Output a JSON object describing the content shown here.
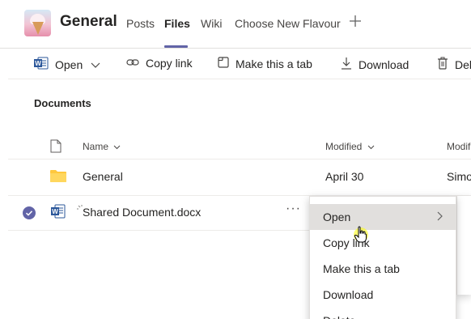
{
  "header": {
    "title": "General",
    "tabs": [
      "Posts",
      "Files",
      "Wiki",
      "Choose New Flavour"
    ],
    "active_tab": "Files",
    "add_tab_icon": "plus-icon"
  },
  "toolbar": {
    "open_label": "Open",
    "copy_link_label": "Copy link",
    "make_tab_label": "Make this a tab",
    "download_label": "Download",
    "delete_label": "Del"
  },
  "documents": {
    "section_title": "Documents",
    "columns": {
      "name": "Name",
      "modified": "Modified",
      "modified_by": "Modifi"
    },
    "rows": [
      {
        "name": "General",
        "type": "folder",
        "modified": "April 30",
        "modified_by": "Simo"
      },
      {
        "name": "Shared Document.docx",
        "type": "word",
        "modified": "",
        "modified_by": "",
        "selected": true,
        "more": "···"
      }
    ]
  },
  "context_menu": {
    "items": [
      "Open",
      "Copy link",
      "Make this a tab",
      "Download",
      "Delete"
    ],
    "hovered": "Open"
  },
  "colors": {
    "accent": "#6264a7",
    "word_blue": "#2b579a",
    "folder_yellow": "#ffc83d",
    "cursor_yellow": "#ffff00"
  }
}
